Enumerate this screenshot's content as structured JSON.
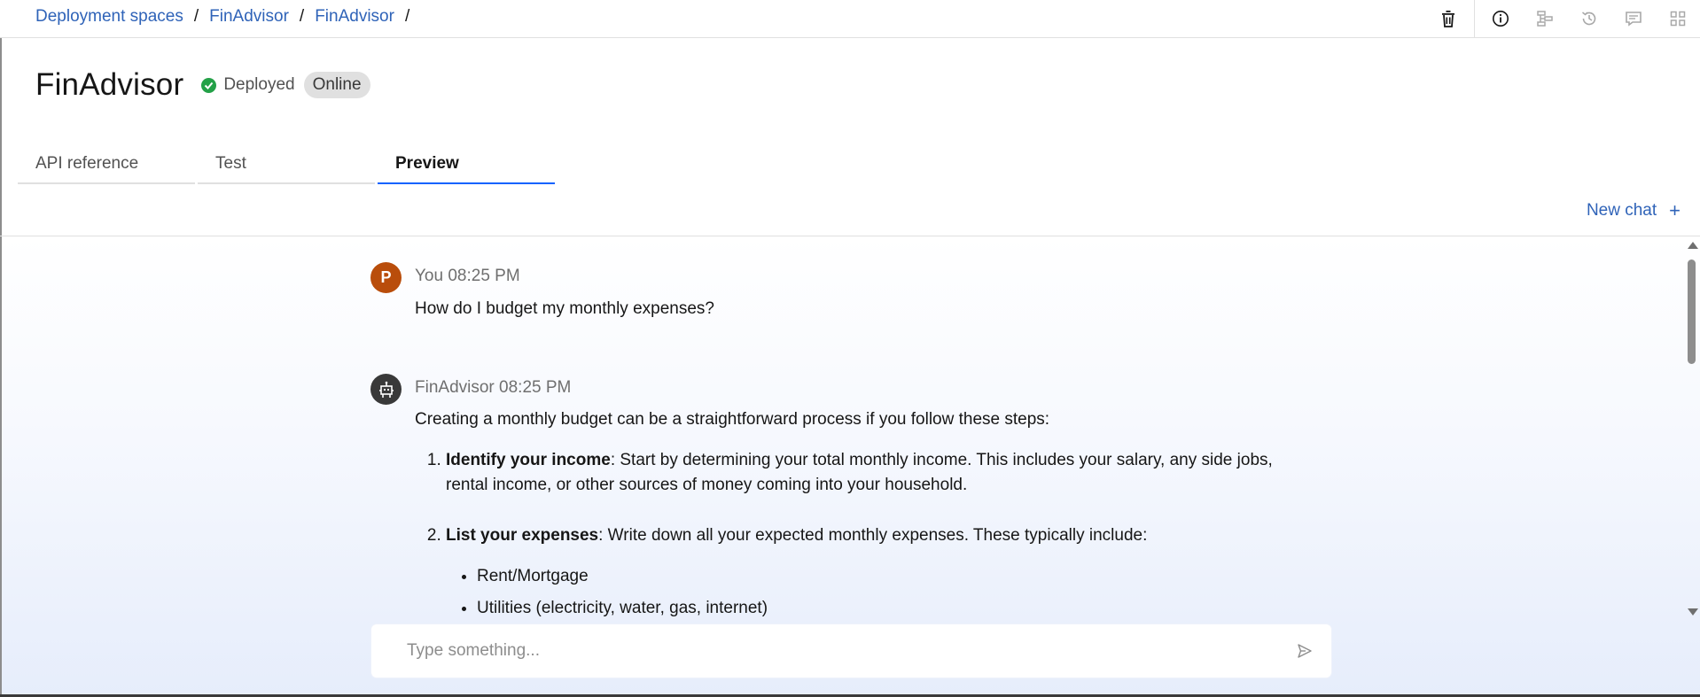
{
  "breadcrumb": {
    "items": [
      "Deployment spaces",
      "FinAdvisor",
      "FinAdvisor"
    ],
    "separator": "/"
  },
  "toolbar": {
    "icons": [
      "trash-icon",
      "info-icon",
      "lineage-icon",
      "history-icon",
      "comment-icon",
      "apps-icon"
    ]
  },
  "header": {
    "title": "FinAdvisor",
    "status": "Deployed",
    "badge": "Online"
  },
  "tabs": [
    {
      "label": "API reference",
      "active": false
    },
    {
      "label": "Test",
      "active": false
    },
    {
      "label": "Preview",
      "active": true
    }
  ],
  "new_chat": {
    "label": "New chat",
    "icon": "+"
  },
  "messages": [
    {
      "avatar": "P",
      "header": "You 08:25 PM",
      "text": "How do I budget my monthly expenses?"
    },
    {
      "avatar_icon": "bot-icon",
      "header": "FinAdvisor 08:25 PM",
      "intro": "Creating a monthly budget can be a straightforward process if you follow these steps:",
      "steps": [
        {
          "number": "1.",
          "title": "Identify your income",
          "text": ": Start by determining your total monthly income. This includes your salary, any side jobs, rental income, or other sources of money coming into your household."
        },
        {
          "number": "2.",
          "title": "List your expenses",
          "text": ": Write down all your expected monthly expenses. These typically include:"
        }
      ],
      "bullets": [
        "Rent/Mortgage",
        "Utilities (electricity, water, gas, internet)"
      ]
    }
  ],
  "input": {
    "placeholder": "Type something...",
    "value": ""
  },
  "colors": {
    "link": "#2f63b8",
    "accent": "#0f62fe",
    "status_ok": "#24a148",
    "user_avatar": "#b94d0b",
    "bot_avatar": "#393939"
  }
}
